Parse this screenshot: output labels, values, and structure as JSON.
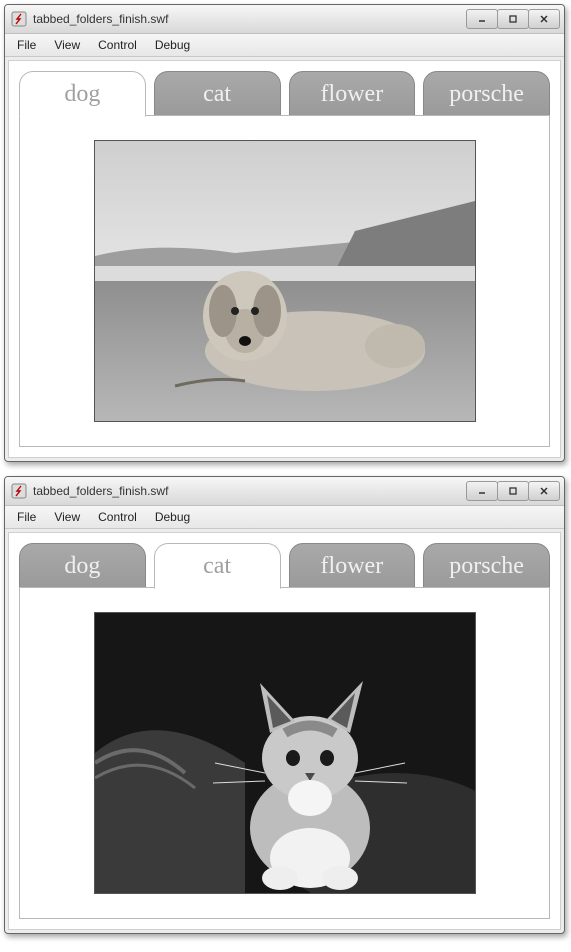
{
  "windows": [
    {
      "title": "tabbed_folders_finish.swf",
      "menu": [
        "File",
        "View",
        "Control",
        "Debug"
      ],
      "activeTab": 0,
      "tabs": [
        "dog",
        "cat",
        "flower",
        "porsche"
      ],
      "imageAlt": "golden retriever lying on a beach with cliffs and ocean behind"
    },
    {
      "title": "tabbed_folders_finish.swf",
      "menu": [
        "File",
        "View",
        "Control",
        "Debug"
      ],
      "activeTab": 1,
      "tabs": [
        "dog",
        "cat",
        "flower",
        "porsche"
      ],
      "imageAlt": "tabby kitten sitting on a blanket on a couch"
    }
  ]
}
